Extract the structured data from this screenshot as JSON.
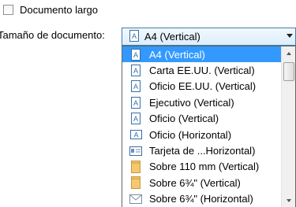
{
  "option": {
    "label": "Documento largo",
    "checked": false
  },
  "size_label": "Tamaño de documento:",
  "combo": {
    "selected": "A4 (Vertical)"
  },
  "dropdown": {
    "items": [
      {
        "label": "A4 (Vertical)",
        "icon": "page-portrait-icon",
        "selected": true
      },
      {
        "label": "Carta EE.UU. (Vertical)",
        "icon": "page-portrait-icon"
      },
      {
        "label": "Oficio EE.UU. (Vertical)",
        "icon": "page-portrait-icon"
      },
      {
        "label": "Ejecutivo (Vertical)",
        "icon": "page-portrait-icon"
      },
      {
        "label": "Oficio (Vertical)",
        "icon": "page-portrait-icon"
      },
      {
        "label": "Oficio (Horizontal)",
        "icon": "page-landscape-icon"
      },
      {
        "label": "Tarjeta de ...Horizontal)",
        "icon": "business-card-icon"
      },
      {
        "label": "Sobre 110 mm (Vertical)",
        "icon": "envelope-icon"
      },
      {
        "label": "Sobre 6¾\" (Vertical)",
        "icon": "envelope-icon"
      },
      {
        "label": "Sobre 6¾\" (Horizontal)",
        "icon": "envelope-landscape-icon"
      }
    ]
  },
  "colors": {
    "selection": "#3399ff",
    "combo_border": "#3c7fb1"
  }
}
